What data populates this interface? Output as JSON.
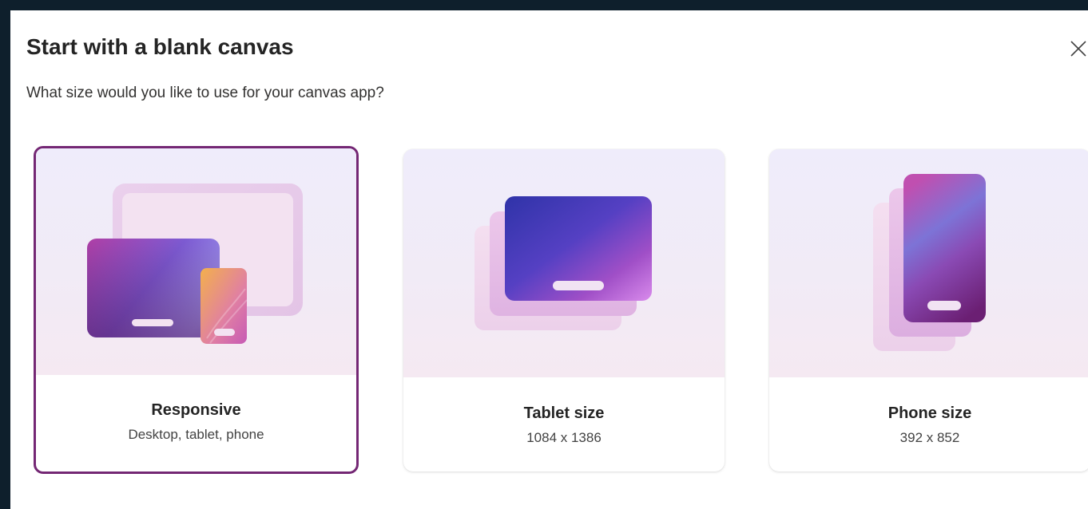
{
  "dialog": {
    "title": "Start with a blank canvas",
    "subtitle": "What size would you like to use for your canvas app?",
    "close_icon": "close-icon"
  },
  "options": [
    {
      "label": "Responsive",
      "description": "Desktop, tablet, phone",
      "selected": true,
      "icon": "responsive-illustration"
    },
    {
      "label": "Tablet size",
      "description": "1084 x 1386",
      "selected": false,
      "icon": "tablet-illustration"
    },
    {
      "label": "Phone size",
      "description": "392 x 852",
      "selected": false,
      "icon": "phone-illustration"
    }
  ],
  "colors": {
    "accent": "#742774",
    "backdrop": "#0e1f2c"
  }
}
